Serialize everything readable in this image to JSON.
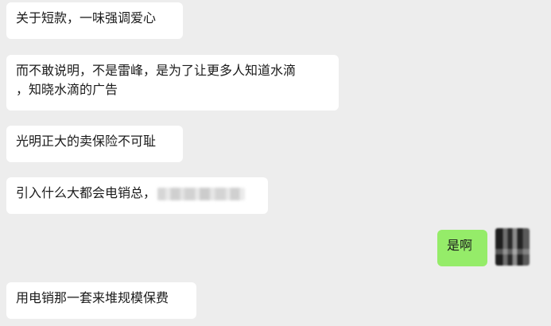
{
  "chat": {
    "messages": [
      {
        "sender": "other",
        "text": "关于短款，一味强调爱心"
      },
      {
        "sender": "other",
        "line1": "而不敢说明，不是雷峰，是为了让更多人知道水滴",
        "line2": "，知晓水滴的广告"
      },
      {
        "sender": "other",
        "text": "光明正大的卖保险不可耻"
      },
      {
        "sender": "other",
        "text": "引入什么大都会电销总，",
        "trailing_blurred": true
      },
      {
        "sender": "self",
        "text": "是啊"
      },
      {
        "sender": "other",
        "text": "用电销那一套来堆规模保费"
      }
    ]
  },
  "colors": {
    "background": "#ededed",
    "bubble_other": "#ffffff",
    "bubble_self": "#95ec69",
    "text": "#1b1b1b"
  }
}
